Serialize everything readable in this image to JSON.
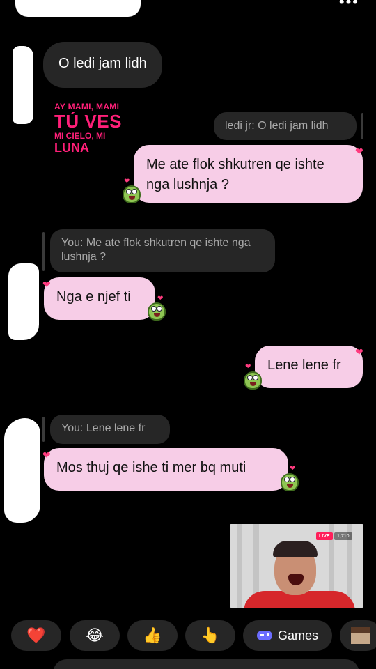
{
  "messages": {
    "m1": {
      "text": "O ledi jam lidh"
    },
    "m2": {
      "reply_to": "ledi jr: O ledi jam lidh",
      "text": "Me ate flok shkutren qe ishte nga lushnja ?"
    },
    "m3": {
      "reply_to": "You: Me ate flok shkutren qe ishte nga lushnja ?",
      "text": "Nga e njef ti"
    },
    "m4": {
      "text": "Lene lene fr"
    },
    "m5": {
      "reply_to": "You: Lene lene fr",
      "text": "Mos thuj qe ishe ti mer bq muti"
    }
  },
  "sticker": {
    "line1": "AY MAMI, MAMI",
    "line2": "TÚ VES",
    "line3": "MI CIELO, MI",
    "line4": "LUNA"
  },
  "live_preview": {
    "badge": "LIVE",
    "viewers": "1,710"
  },
  "quick_reactions": {
    "heart": "❤️",
    "laugh": "😂",
    "thumbs_up": "👍",
    "point": "👆",
    "games": "Games"
  },
  "colors": {
    "background": "#000000",
    "incoming_bubble": "#262626",
    "outgoing_bubble": "#f7cde7",
    "sticker_pink": "#ff1f78"
  }
}
